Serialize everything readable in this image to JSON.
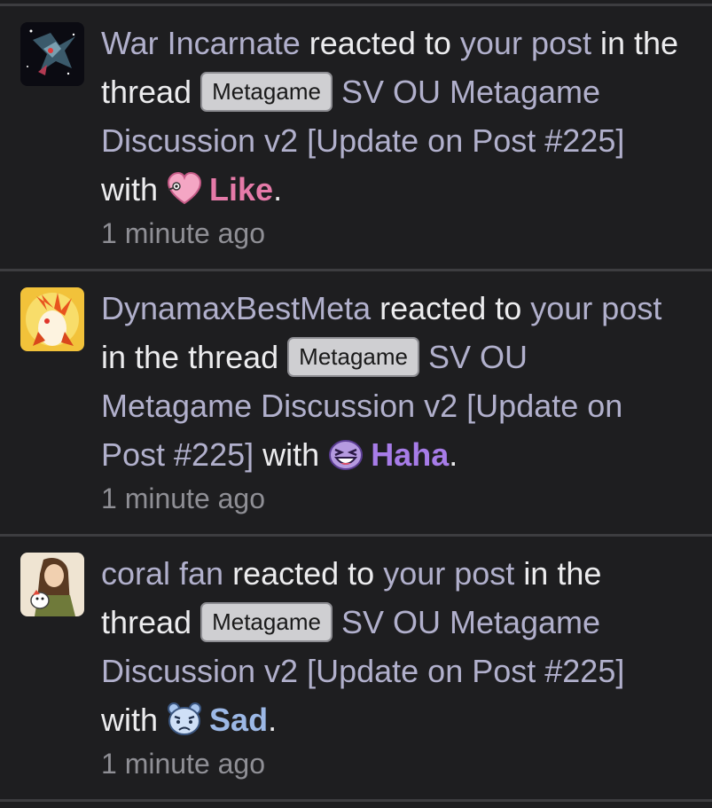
{
  "alerts": [
    {
      "user": "War Incarnate",
      "reacted": "reacted to",
      "your_post": "your post",
      "in_the": "in the",
      "thread": "thread",
      "prefix": "Metagame",
      "title_a": "SV OU Metagame",
      "title_b": "Discussion v2 [Update on Post #225]",
      "with": "with",
      "reaction": "Like",
      "reaction_color": "#e57aa8",
      "time": "1 minute ago"
    },
    {
      "user": "DynamaxBestMeta",
      "reacted": "reacted to",
      "your_post": "your post",
      "in_the": "in the thread",
      "prefix": "Metagame",
      "title_a": "SV OU",
      "title_b": "Metagame Discussion v2 [Update on",
      "title_c": "Post #225]",
      "with": "with",
      "reaction": "Haha",
      "reaction_color": "#a77ce8",
      "time": "1 minute ago"
    },
    {
      "user": "coral fan",
      "reacted": "reacted to",
      "your_post": "your post",
      "in_the": "in the",
      "thread": "thread",
      "prefix": "Metagame",
      "title_a": "SV OU Metagame",
      "title_b": "Discussion v2 [Update on Post #225]",
      "with": "with",
      "reaction": "Sad",
      "reaction_color": "#9cb8e6",
      "time": "1 minute ago"
    }
  ]
}
